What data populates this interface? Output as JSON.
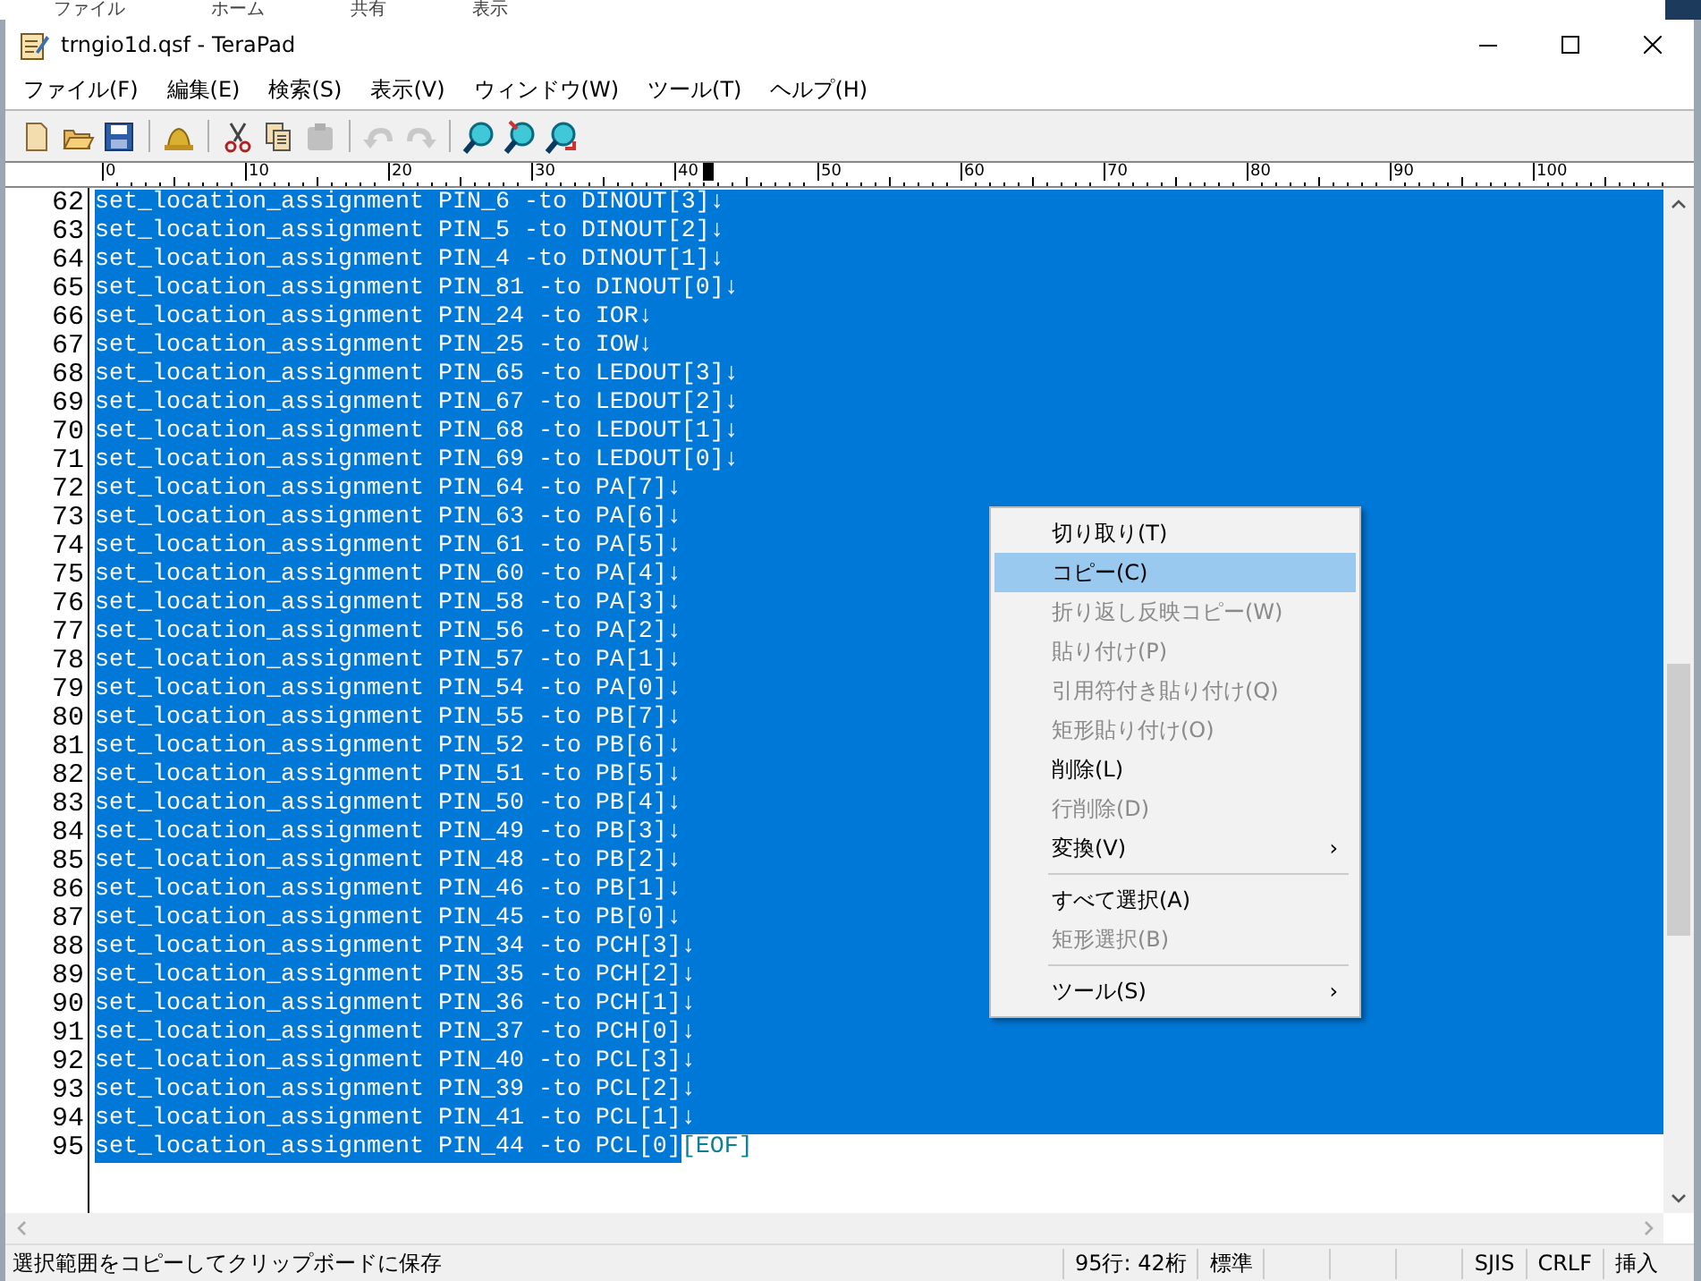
{
  "background_ribbon": {
    "tabs": [
      "ファイル",
      "ホーム",
      "共有",
      "表示"
    ]
  },
  "window": {
    "title": "trngio1d.qsf - TeraPad"
  },
  "menu_bar": [
    "ファイル(F)",
    "編集(E)",
    "検索(S)",
    "表示(V)",
    "ウィンドウ(W)",
    "ツール(T)",
    "ヘルプ(H)"
  ],
  "toolbar": [
    {
      "kind": "new",
      "disabled": false
    },
    {
      "kind": "open",
      "disabled": false
    },
    {
      "kind": "save",
      "disabled": false
    },
    {
      "kind": "separator"
    },
    {
      "kind": "print",
      "disabled": false
    },
    {
      "kind": "separator"
    },
    {
      "kind": "cut",
      "disabled": false
    },
    {
      "kind": "copy",
      "disabled": false
    },
    {
      "kind": "paste",
      "disabled": true
    },
    {
      "kind": "separator"
    },
    {
      "kind": "undo",
      "disabled": true
    },
    {
      "kind": "redo",
      "disabled": true
    },
    {
      "kind": "separator"
    },
    {
      "kind": "find",
      "disabled": false
    },
    {
      "kind": "find-next",
      "disabled": false
    },
    {
      "kind": "find-prev",
      "disabled": false
    }
  ],
  "ruler": {
    "labels": [
      "0",
      "10",
      "20",
      "30",
      "40",
      "50",
      "60",
      "70",
      "80",
      "90",
      "100"
    ]
  },
  "editor": {
    "lines": [
      {
        "number": "62",
        "text": "set_location_assignment PIN_6 -to DINOUT[3]↓",
        "selected": true
      },
      {
        "number": "63",
        "text": "set_location_assignment PIN_5 -to DINOUT[2]↓",
        "selected": true
      },
      {
        "number": "64",
        "text": "set_location_assignment PIN_4 -to DINOUT[1]↓",
        "selected": true
      },
      {
        "number": "65",
        "text": "set_location_assignment PIN_81 -to DINOUT[0]↓",
        "selected": true
      },
      {
        "number": "66",
        "text": "set_location_assignment PIN_24 -to IOR↓",
        "selected": true
      },
      {
        "number": "67",
        "text": "set_location_assignment PIN_25 -to IOW↓",
        "selected": true
      },
      {
        "number": "68",
        "text": "set_location_assignment PIN_65 -to LEDOUT[3]↓",
        "selected": true
      },
      {
        "number": "69",
        "text": "set_location_assignment PIN_67 -to LEDOUT[2]↓",
        "selected": true
      },
      {
        "number": "70",
        "text": "set_location_assignment PIN_68 -to LEDOUT[1]↓",
        "selected": true
      },
      {
        "number": "71",
        "text": "set_location_assignment PIN_69 -to LEDOUT[0]↓",
        "selected": true
      },
      {
        "number": "72",
        "text": "set_location_assignment PIN_64 -to PA[7]↓",
        "selected": true
      },
      {
        "number": "73",
        "text": "set_location_assignment PIN_63 -to PA[6]↓",
        "selected": true
      },
      {
        "number": "74",
        "text": "set_location_assignment PIN_61 -to PA[5]↓",
        "selected": true
      },
      {
        "number": "75",
        "text": "set_location_assignment PIN_60 -to PA[4]↓",
        "selected": true
      },
      {
        "number": "76",
        "text": "set_location_assignment PIN_58 -to PA[3]↓",
        "selected": true
      },
      {
        "number": "77",
        "text": "set_location_assignment PIN_56 -to PA[2]↓",
        "selected": true
      },
      {
        "number": "78",
        "text": "set_location_assignment PIN_57 -to PA[1]↓",
        "selected": true
      },
      {
        "number": "79",
        "text": "set_location_assignment PIN_54 -to PA[0]↓",
        "selected": true
      },
      {
        "number": "80",
        "text": "set_location_assignment PIN_55 -to PB[7]↓",
        "selected": true
      },
      {
        "number": "81",
        "text": "set_location_assignment PIN_52 -to PB[6]↓",
        "selected": true
      },
      {
        "number": "82",
        "text": "set_location_assignment PIN_51 -to PB[5]↓",
        "selected": true
      },
      {
        "number": "83",
        "text": "set_location_assignment PIN_50 -to PB[4]↓",
        "selected": true
      },
      {
        "number": "84",
        "text": "set_location_assignment PIN_49 -to PB[3]↓",
        "selected": true
      },
      {
        "number": "85",
        "text": "set_location_assignment PIN_48 -to PB[2]↓",
        "selected": true
      },
      {
        "number": "86",
        "text": "set_location_assignment PIN_46 -to PB[1]↓",
        "selected": true
      },
      {
        "number": "87",
        "text": "set_location_assignment PIN_45 -to PB[0]↓",
        "selected": true
      },
      {
        "number": "88",
        "text": "set_location_assignment PIN_34 -to PCH[3]↓",
        "selected": true
      },
      {
        "number": "89",
        "text": "set_location_assignment PIN_35 -to PCH[2]↓",
        "selected": true
      },
      {
        "number": "90",
        "text": "set_location_assignment PIN_36 -to PCH[1]↓",
        "selected": true
      },
      {
        "number": "91",
        "text": "set_location_assignment PIN_37 -to PCH[0]↓",
        "selected": true
      },
      {
        "number": "92",
        "text": "set_location_assignment PIN_40 -to PCL[3]↓",
        "selected": true
      },
      {
        "number": "93",
        "text": "set_location_assignment PIN_39 -to PCL[2]↓",
        "selected": true
      },
      {
        "number": "94",
        "text": "set_location_assignment PIN_41 -to PCL[1]↓",
        "selected": true
      },
      {
        "number": "95",
        "text": "set_location_assignment PIN_44 -to PCL[0]",
        "selected": true,
        "eof": "[EOF]"
      }
    ]
  },
  "context_menu": {
    "items": [
      {
        "kind": "item",
        "label": "切り取り(T)",
        "disabled": false,
        "selected": false
      },
      {
        "kind": "item",
        "label": "コピー(C)",
        "disabled": false,
        "selected": true
      },
      {
        "kind": "item",
        "label": "折り返し反映コピー(W)",
        "disabled": true,
        "selected": false
      },
      {
        "kind": "item",
        "label": "貼り付け(P)",
        "disabled": true,
        "selected": false
      },
      {
        "kind": "item",
        "label": "引用符付き貼り付け(Q)",
        "disabled": true,
        "selected": false
      },
      {
        "kind": "item",
        "label": "矩形貼り付け(O)",
        "disabled": true,
        "selected": false
      },
      {
        "kind": "item",
        "label": "削除(L)",
        "disabled": false,
        "selected": false
      },
      {
        "kind": "item",
        "label": "行削除(D)",
        "disabled": true,
        "selected": false
      },
      {
        "kind": "item",
        "label": "変換(V)",
        "disabled": false,
        "selected": false,
        "submenu": "›"
      },
      {
        "kind": "separator"
      },
      {
        "kind": "item",
        "label": "すべて選択(A)",
        "disabled": false,
        "selected": false
      },
      {
        "kind": "item",
        "label": "矩形選択(B)",
        "disabled": true,
        "selected": false
      },
      {
        "kind": "separator"
      },
      {
        "kind": "item",
        "label": "ツール(S)",
        "disabled": false,
        "selected": false,
        "submenu": "›"
      }
    ]
  },
  "status_bar": {
    "message": "選択範囲をコピーしてクリップボードに保存",
    "position": "95行: 42桁",
    "mode": "標準",
    "encoding": "SJIS",
    "line_ending": "CRLF",
    "input_mode": "挿入"
  }
}
